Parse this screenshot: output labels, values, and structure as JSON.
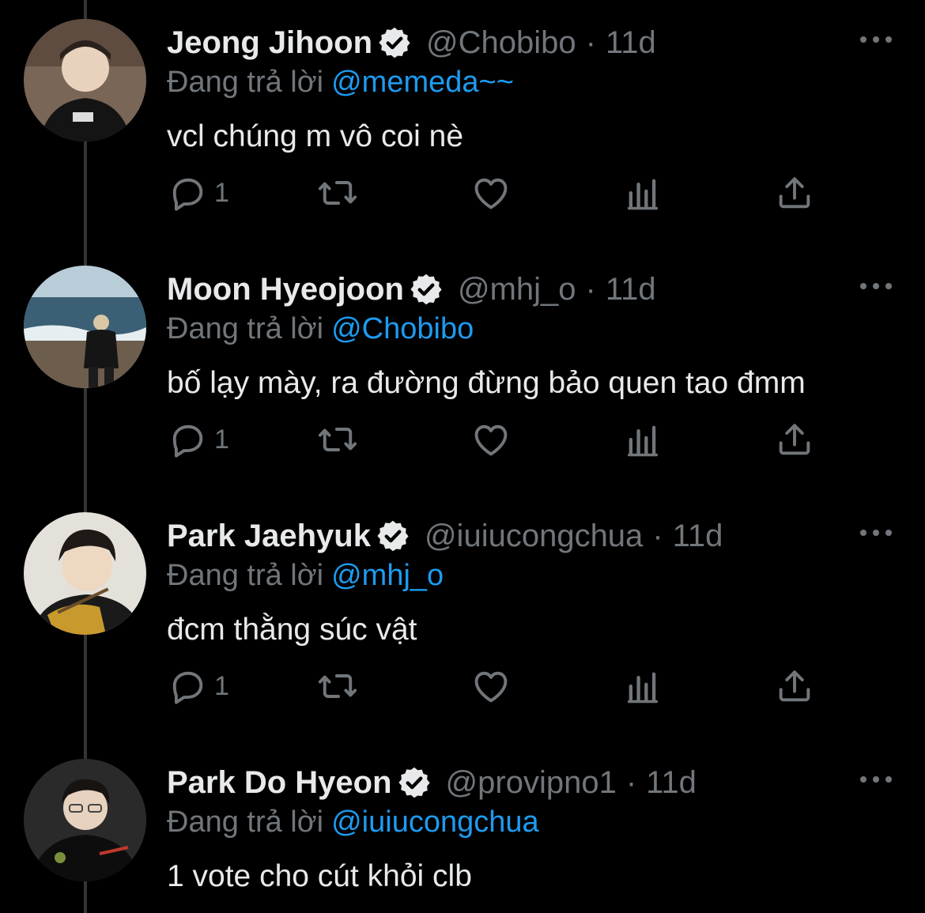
{
  "reply_prefix": "Đang trả lời",
  "tweets": [
    {
      "name": "Jeong Jihoon",
      "handle": "@Chobibo",
      "separator": "·",
      "time": "11d",
      "reply_to": "@memeda~~",
      "text": "vcl chúng m vô coi nè",
      "reply_count": "1",
      "avatar_bg": "#6b5a4e"
    },
    {
      "name": "Moon Hyeojoon",
      "handle": "@mhj_o",
      "separator": "·",
      "time": "11d",
      "reply_to": "@Chobibo",
      "text": "bố lạy mày, ra đường đừng bảo quen tao đmm",
      "reply_count": "1",
      "avatar_bg": "#9fb9c7"
    },
    {
      "name": "Park Jaehyuk",
      "handle": "@iuiucongchua",
      "separator": "·",
      "time": "11d",
      "reply_to": "@mhj_o",
      "text": "đcm thằng súc vật",
      "reply_count": "1",
      "avatar_bg": "#d9d6cf"
    },
    {
      "name": "Park Do Hyeon",
      "handle": "@provipno1",
      "separator": "·",
      "time": "11d",
      "reply_to": "@iuiucongchua",
      "text": "1 vote cho cút khỏi clb",
      "reply_count": "",
      "avatar_bg": "#2b2b2b"
    }
  ],
  "colors": {
    "background": "#000000",
    "text": "#e7e9ea",
    "secondary": "#71767b",
    "accent": "#1d9bf0",
    "thread_line": "#333639"
  },
  "icons": [
    "verified-badge-icon",
    "more-options-icon",
    "reply-icon",
    "retweet-icon",
    "like-icon",
    "views-icon",
    "share-icon"
  ]
}
